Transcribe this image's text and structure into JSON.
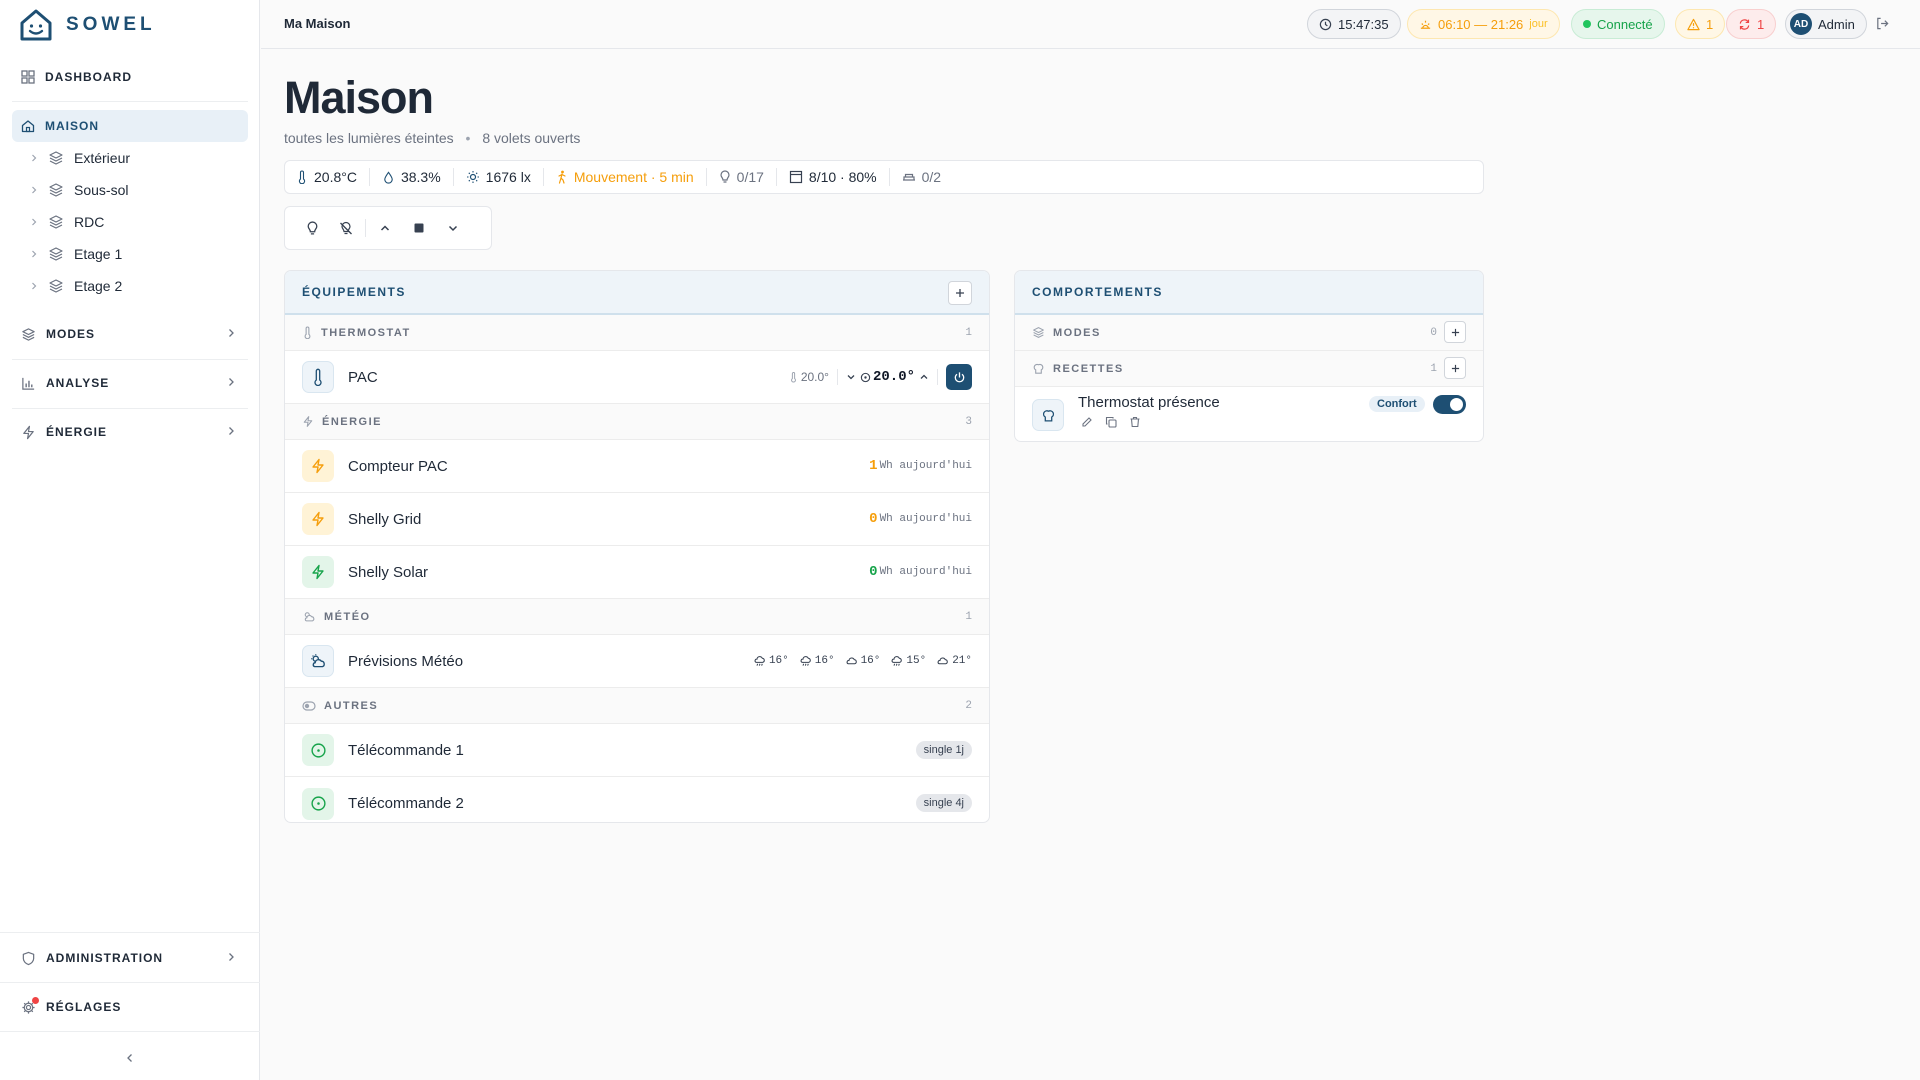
{
  "app": {
    "name": "SOWEL"
  },
  "sidebar": {
    "dashboard": "DASHBOARD",
    "maison": "MAISON",
    "zones": [
      "Extérieur",
      "Sous-sol",
      "RDC",
      "Etage 1",
      "Etage 2"
    ],
    "modes": "MODES",
    "analyse": "ANALYSE",
    "energie": "ÉNERGIE",
    "administration": "ADMINISTRATION",
    "reglages": "RÉGLAGES"
  },
  "header": {
    "breadcrumb": "Ma Maison",
    "time": "15:47:35",
    "sun_range": "06:10 — 21:26",
    "sun_label": "jour",
    "status": "Connecté",
    "warnings": "1",
    "errors": "1",
    "user_initials": "AD",
    "user_name": "Admin"
  },
  "page": {
    "title": "Maison",
    "subtitle_lights": "toutes les lumières éteintes",
    "subtitle_sep": "•",
    "subtitle_shutters": "8 volets ouverts"
  },
  "sensors": {
    "temperature": "20.8°C",
    "humidity": "38.3%",
    "luminosity": "1676 lx",
    "motion": "Mouvement · 5 min",
    "lights": "0/17",
    "shutters": "8/10 · 80%",
    "windows": "0/2"
  },
  "equipments": {
    "title": "ÉQUIPEMENTS",
    "groups": {
      "thermostat": {
        "label": "THERMOSTAT",
        "count": "1"
      },
      "energie": {
        "label": "ÉNERGIE",
        "count": "3"
      },
      "meteo": {
        "label": "MÉTÉO",
        "count": "1"
      },
      "autres": {
        "label": "AUTRES",
        "count": "2"
      }
    },
    "pac": {
      "name": "PAC",
      "current": "20.0°",
      "setpoint": "20.0°"
    },
    "energy": [
      {
        "name": "Compteur PAC",
        "value": "1",
        "unit": "Wh aujourd'hui"
      },
      {
        "name": "Shelly Grid",
        "value": "0",
        "unit": "Wh aujourd'hui"
      },
      {
        "name": "Shelly Solar",
        "value": "0",
        "unit": "Wh aujourd'hui"
      }
    ],
    "meteo": {
      "name": "Prévisions Météo",
      "forecast": [
        "16°",
        "16°",
        "16°",
        "15°",
        "21°"
      ]
    },
    "remotes": [
      {
        "name": "Télécommande 1",
        "tag": "single 1j"
      },
      {
        "name": "Télécommande 2",
        "tag": "single 4j"
      }
    ]
  },
  "behaviors": {
    "title": "COMPORTEMENTS",
    "modes": {
      "label": "MODES",
      "count": "0"
    },
    "recettes": {
      "label": "RECETTES",
      "count": "1"
    },
    "recipe": {
      "name": "Thermostat présence",
      "tag": "Confort",
      "enabled": true
    }
  },
  "colors": {
    "accent": "#1e4f73",
    "energy_yellow": "#f59e0b",
    "energy_green": "#16a34a",
    "ok": "#16a34a",
    "warn": "#f59e0b",
    "err": "#ef4444"
  }
}
